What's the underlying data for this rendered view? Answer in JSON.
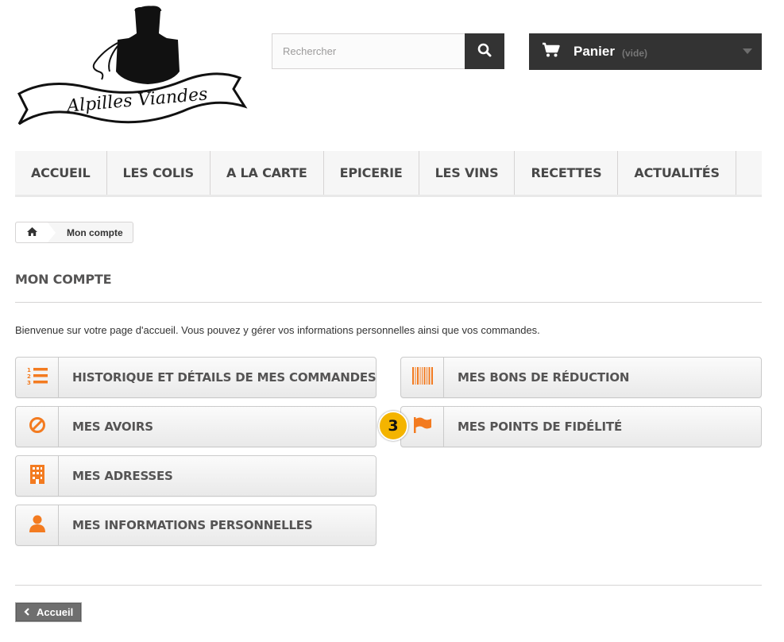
{
  "header": {
    "logo_text": "Alpilles Viandes",
    "search": {
      "placeholder": "Rechercher",
      "value": ""
    },
    "cart": {
      "label": "Panier",
      "status": "(vide)"
    }
  },
  "menu": {
    "items": [
      "ACCUEIL",
      "LES COLIS",
      "A LA CARTE",
      "EPICERIE",
      "LES VINS",
      "RECETTES",
      "ACTUALITÉS"
    ]
  },
  "breadcrumb": {
    "current": "Mon compte"
  },
  "page": {
    "title": "MON COMPTE",
    "intro": "Bienvenue sur votre page d'accueil. Vous pouvez y gérer vos informations personnelles ainsi que vos commandes."
  },
  "account_links": {
    "orders": "HISTORIQUE ET DÉTAILS DE MES COMMANDES",
    "vouchers": "MES BONS DE RÉDUCTION",
    "credit_slips": "MES AVOIRS",
    "loyalty": "MES POINTS DE FIDÉLITÉ",
    "addresses": "MES ADRESSES",
    "personal_info": "MES INFORMATIONS PERSONNELLES"
  },
  "annotation_badge": "3",
  "footer": {
    "back_label": "Accueil"
  },
  "colors": {
    "accent": "#f37b20",
    "dark": "#333333",
    "badge": "#f4b400"
  }
}
